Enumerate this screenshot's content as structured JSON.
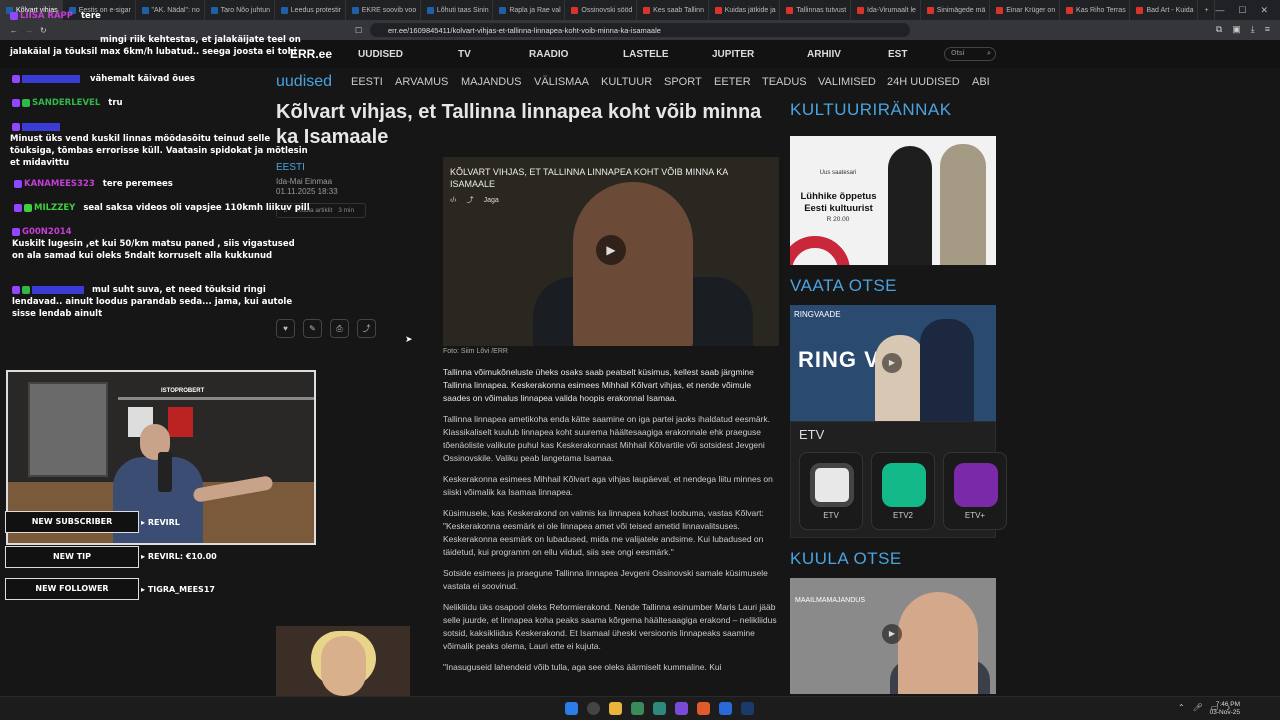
{
  "browser": {
    "tabs": [
      "Kõlvart vihjas",
      "Eestis on e-sigar",
      "\"AK. Nädal\": no",
      "Taro Nõo juhtun",
      "Leedus protestir",
      "EKRE soovib voo",
      "Lõhuti taas Sinin",
      "Rapla ja Rae val",
      "Ossinovski sööd",
      "Kes saab Tallinn",
      "Kuidas jätkide ja",
      "Tallinnas tutvust",
      "Ida-Virumaalt le",
      "Sinimägede mä",
      "Einar Krüger on",
      "Kas Riho Terras",
      "Bad Art - Kuida"
    ],
    "url": "err.ee/1609845411/kolvart-vihjas-et-tallinna-linnapea-koht-voib-minna-ka-isamaale"
  },
  "site": {
    "logo": "ERR.ee",
    "topnav": [
      "UUDISED",
      "TV",
      "RAADIO",
      "LASTELE",
      "JUPITER",
      "ARHIIV",
      "EST"
    ],
    "search_placeholder": "Otsi",
    "brand": "uudised",
    "secnav": [
      "EESTI",
      "ARVAMUS",
      "MAJANDUS",
      "VÄLISMAA",
      "KULTUUR",
      "SPORT",
      "EETER",
      "TEADUS",
      "VALIMISED",
      "24H UUDISED",
      "ABI"
    ]
  },
  "article": {
    "headline": "Kõlvart vihjas, et Tallinna linnapea koht võib minna ka Isamaale",
    "category": "EESTI",
    "author": "Ida-Mai Einmaa",
    "date": "01.11.2025 18:33",
    "read_label": "Kuula artiklit",
    "read_time": "3 min",
    "video_title": "KÕLVART VIHJAS, ET TALLINNA LINNAPEA KOHT VÕIB MINNA KA ISAMAALE",
    "share": "Jaga",
    "caption": "Foto: Siim Lõvi /ERR",
    "paragraphs": [
      "Tallinna võimukõneluste üheks osaks saab peatselt küsimus, kellest saab järgmine Tallinna linnapea. Keskerakonna esimees Mihhail Kõlvart vihjas, et nende võimule saades on võimalus linnapea valida hoopis erakonnal Isamaa.",
      "Tallinna linnapea ametikoha enda kätte saamine on iga partei jaoks ihaldatud eesmärk. Klassikaliselt kuulub linnapea koht suurema häältesaagiga erakonnale ehk praeguse tõenäoliste valikute puhul kas Keskerakonnast Mihhail Kõlvartile või sotsidest Jevgeni Ossinovskile. Valiku peab langetama Isamaa.",
      "Keskerakonna esimees Mihhail Kõlvart aga vihjas laupäeval, et nendega liitu minnes on siiski võimalik ka Isamaa linnapea.",
      "Küsimusele, kas Keskerakond on valmis ka linnapea kohast loobuma, vastas Kõlvart: \"Keskerakonna eesmärk ei ole linnapea amet või teised ametid linnavalitsuses. Keskerakonna eesmärk on lubadused, mida me valijatele andsime. Kui lubadused on täidetud, kui programm on ellu viidud, siis see ongi eesmärk.\"",
      "Sotside esimees ja praegune Tallinna linnapea Jevgeni Ossinovski samale küsimusele vastata ei soovinud.",
      "Nelikliidu üks osapool oleks Reformierakond. Nende Tallinna esinumber Maris Lauri jääb selle juurde, et linnapea koha peaks saama kõrgema häältesaagiga erakond – nelikliidus sotsid, kaksikliidus Keskerakond. Et Isamaal üheski versioonis linnapeaks saamine võimalik peaks olema, Lauri ette ei kujuta.",
      "\"Inasuguseid lahendeid võib tulla, aga see oleks äärmiselt kummaline. Kui"
    ]
  },
  "sidebar": {
    "kultuur_heading": "KULTUURIRÄNNAK",
    "kultuur_card": {
      "badge": "Uus saatesari",
      "title": "Lühhike õppetus Eesti kultuurist",
      "date": "R 20.00"
    },
    "vaata_heading": "VAATA OTSE",
    "vaata_label": "RINGVAADE",
    "vaata_big": "RING VAADE",
    "etv_title": "ETV",
    "channels": [
      "ETV",
      "ETV2",
      "ETV+"
    ],
    "kuula_heading": "KUULA OTSE",
    "kuula_label": "MAAILMAMAJANDUS"
  },
  "stream": {
    "chat": [
      {
        "user": "LIISA RÄPP",
        "text": "tere",
        "color": "#c33fd6"
      },
      {
        "user": "",
        "text": "mingi riik kehtestas, et jalakäijate teel on jalakäial ja tõuksil max 6km/h lubatud.. seega joosta ei tohi",
        "color": "#3b3bd6"
      },
      {
        "user": "",
        "text": "vähemalt käivad õues",
        "color": "#3b3bd6"
      },
      {
        "user": "SANDERLEVEL",
        "text": "tru",
        "color": "#2fb84a"
      },
      {
        "user": "",
        "text": "Minust üks vend kuskil linnas möödasõitu teinud selle tõuksiga, tõmbas errorisse küll. Vaatasin spidokat ja mõtlesin et midavittu",
        "color": "#3b3bd6"
      },
      {
        "user": "KANAMEES323",
        "text": "tere peremees",
        "color": "#c33fd6"
      },
      {
        "user": "MILZZEY",
        "text": "seal saksa videos oli vapsjee 110kmh liikuv pill",
        "color": "#3ecf3e"
      },
      {
        "user": "G00N2014",
        "text": "Kuskilt lugesin ,et kui 50/km matsu paned , siis vigastused on ala samad kui oleks 5ndalt korruselt alla kukkunud",
        "color": "#c33fd6"
      },
      {
        "user": "",
        "text": "mul suht suva, et need tõuksid ringi lendavad.. ainult loodus parandab seda... jama, kui autole sisse lendab ainult",
        "color": "#3b3bd6"
      }
    ],
    "cam_label": "ISTOPROBERT",
    "alerts": [
      {
        "label": "NEW SUBSCRIBER",
        "value": "REVIRL"
      },
      {
        "label": "NEW TIP",
        "value": "REVIRL: €10.00"
      },
      {
        "label": "NEW FOLLOWER",
        "value": "TIGRA_MEES17"
      }
    ]
  },
  "taskbar": {
    "time": "7:46 PM",
    "date": "03-Nov-25"
  }
}
